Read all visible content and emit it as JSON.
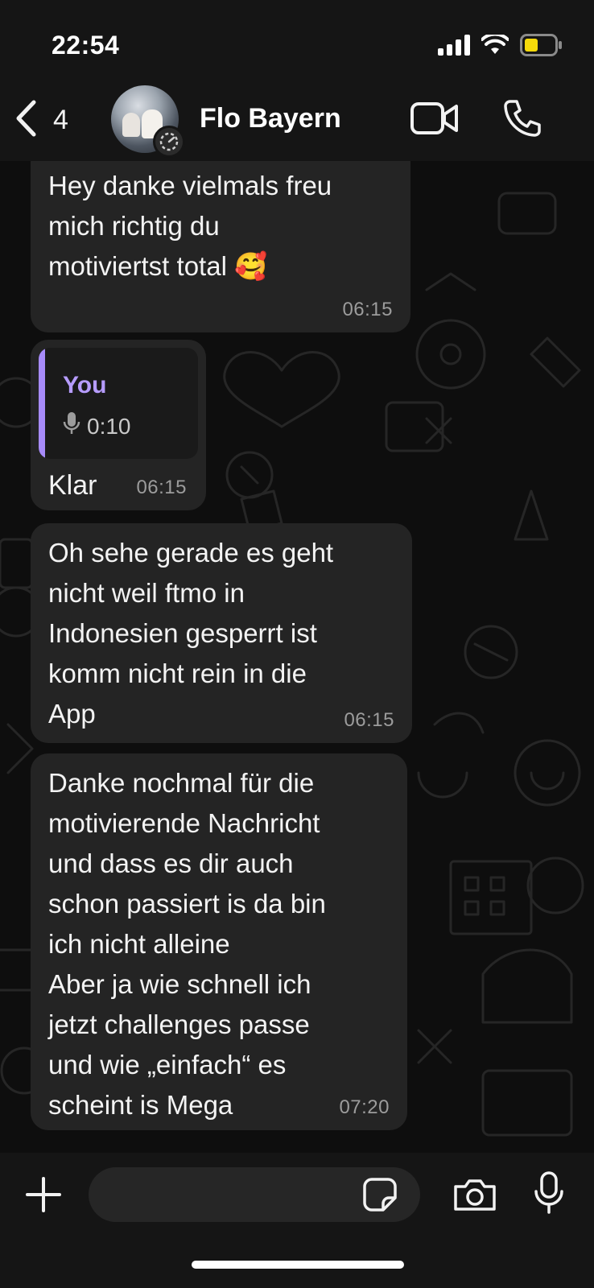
{
  "status_bar": {
    "time": "22:54",
    "icons": [
      "signal-icon",
      "wifi-icon",
      "battery-low-icon"
    ],
    "battery_color": "#f5d90a"
  },
  "header": {
    "back_count": "4",
    "contact_name": "Flo Bayern",
    "icons": [
      "back-chevron-icon",
      "avatar",
      "status-ring-icon",
      "video-call-icon",
      "phone-call-icon"
    ]
  },
  "messages": [
    {
      "text": "Hey danke vielmals freu\nmich richtig du\nmotiviertst total 🥰",
      "time": "06:15"
    },
    {
      "quote_author": "You",
      "quote_duration": "0:10",
      "text": "Klar",
      "time": "06:15"
    },
    {
      "text": "Oh sehe gerade es geht\nnicht weil ftmo in\nIndonesien gesperrt ist\nkomm nicht rein in die\nApp",
      "time": "06:15"
    },
    {
      "text": "Danke nochmal für die\nmotivierende Nachricht\nund dass es dir auch\nschon passiert is da bin\nich nicht alleine\nAber ja wie schnell ich\njetzt challenges passe\nund wie „einfach“ es\nscheint is Mega",
      "time": "07:20"
    }
  ],
  "composer": {
    "icons": [
      "plus-icon",
      "sticker-icon",
      "camera-icon",
      "microphone-icon"
    ]
  },
  "colors": {
    "accent_quote": "#a78bfa",
    "bubble_bg": "#242424",
    "timestamp": "#9c9c9c"
  }
}
